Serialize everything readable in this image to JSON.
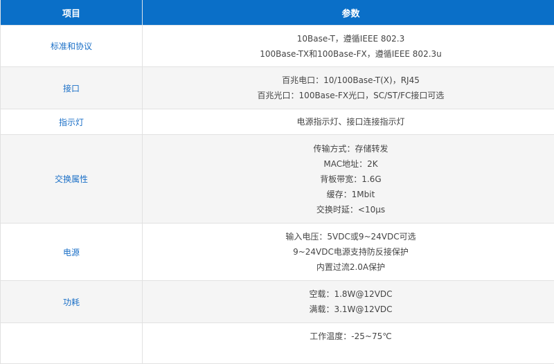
{
  "table": {
    "headers": [
      "项目",
      "参数"
    ],
    "rows": [
      {
        "item": "标准和协议",
        "params": [
          "10Base-T，遵循IEEE 802.3",
          "100Base-TX和100Base-FX，遵循IEEE 802.3u"
        ]
      },
      {
        "item": "接口",
        "params": [
          "百兆电口：10/100Base-T(X)，RJ45",
          "百兆光口：100Base-FX光口，SC/ST/FC接口可选"
        ]
      },
      {
        "item": "指示灯",
        "params": [
          "电源指示灯、接口连接指示灯"
        ]
      },
      {
        "item": "交换属性",
        "params": [
          "传输方式：存储转发",
          "MAC地址：2K",
          "背板带宽：1.6G",
          "缓存：1Mbit",
          "交换时延：<10μs"
        ]
      },
      {
        "item": "电源",
        "params": [
          "输入电压：5VDC或9~24VDC可选",
          "9~24VDC电源支持防反接保护",
          "内置过流2.0A保护"
        ]
      },
      {
        "item": "功耗",
        "params": [
          "空载：1.8W@12VDC",
          "满载：3.1W@12VDC"
        ]
      },
      {
        "item": "",
        "params": [
          "工作温度：-25~75℃"
        ]
      }
    ]
  },
  "colors": {
    "header_bg": "#0a6fc8",
    "item_text": "#1a6fc7",
    "stripe_bg": "#f5f5f5"
  }
}
